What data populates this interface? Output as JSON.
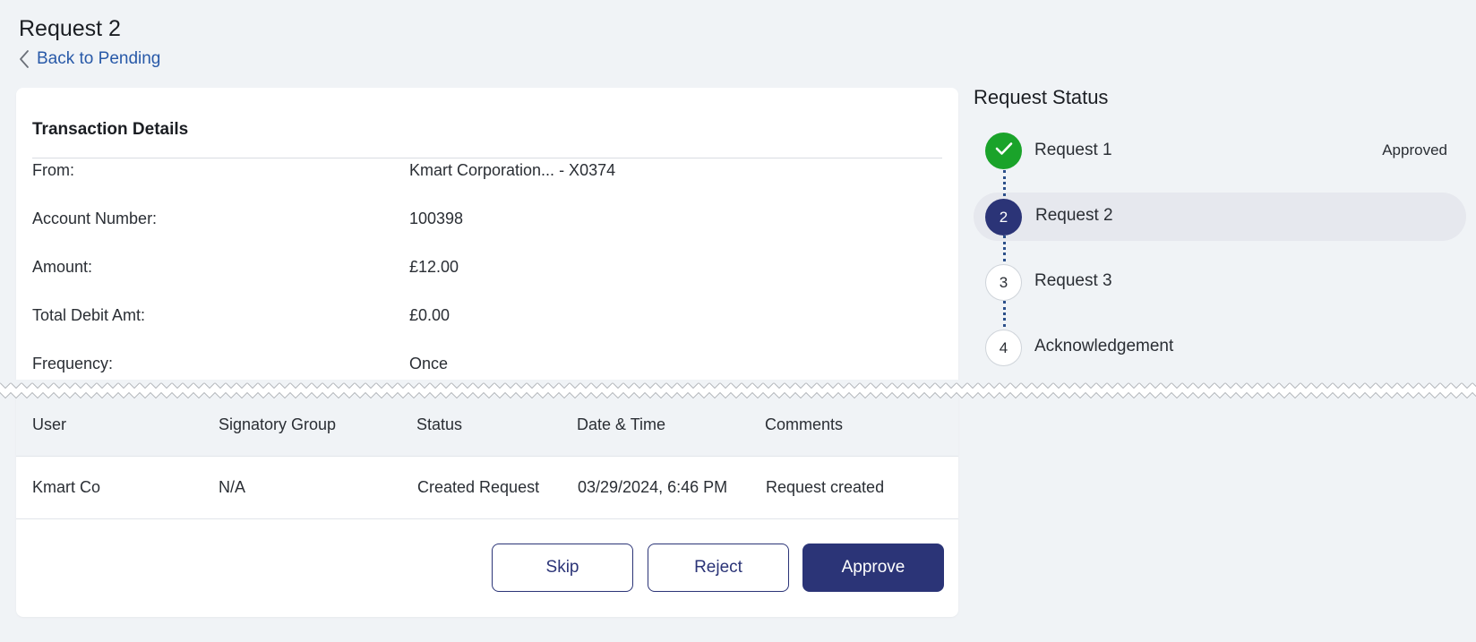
{
  "header": {
    "title": "Request 2",
    "back_label": "Back to Pending"
  },
  "transaction": {
    "heading": "Transaction Details",
    "rows": [
      {
        "label": "From:",
        "value": "Kmart Corporation... - X0374"
      },
      {
        "label": "Account Number:",
        "value": "100398"
      },
      {
        "label": "Amount:",
        "value": "£12.00"
      },
      {
        "label": "Total Debit Amt:",
        "value": "£0.00"
      },
      {
        "label": "Frequency:",
        "value": "Once"
      }
    ]
  },
  "history": {
    "columns": [
      "User",
      "Signatory Group",
      "Status",
      "Date & Time",
      "Comments"
    ],
    "rows": [
      [
        "Kmart Co",
        "N/A",
        "Created Request",
        "03/29/2024, 6:46 PM",
        "Request created"
      ]
    ]
  },
  "actions": {
    "skip": "Skip",
    "reject": "Reject",
    "approve": "Approve"
  },
  "request_status": {
    "title": "Request Status",
    "steps": [
      {
        "marker": "",
        "label": "Request 1",
        "status": "Approved",
        "state": "done"
      },
      {
        "marker": "2",
        "label": "Request 2",
        "status": "",
        "state": "current"
      },
      {
        "marker": "3",
        "label": "Request 3",
        "status": "",
        "state": "todo"
      },
      {
        "marker": "4",
        "label": "Acknowledgement",
        "status": "",
        "state": "todo"
      }
    ]
  },
  "colors": {
    "primary": "#2b3477",
    "link": "#2859a8",
    "success": "#1aa32a",
    "background": "#f0f3f6"
  },
  "icons": {
    "back": "chevron-left-icon",
    "done_step": "check-icon"
  }
}
